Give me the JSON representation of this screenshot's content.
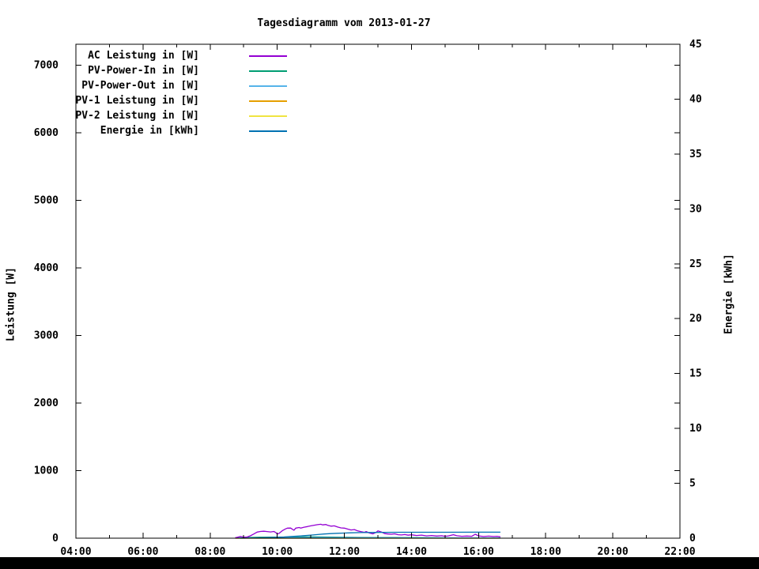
{
  "colors": {
    "background": "#ffffff",
    "foreground": "#000000",
    "bottom_bar": "#000000"
  },
  "chart_data": {
    "type": "line",
    "title": "Tagesdiagramm vom 2013-01-27",
    "x_axis": {
      "start_hour": 4,
      "end_hour": 22,
      "major_step_hours": 2,
      "minor_step_hours": 1,
      "tick_labels": [
        "04:00",
        "06:00",
        "08:00",
        "10:00",
        "12:00",
        "14:00",
        "16:00",
        "18:00",
        "20:00",
        "22:00"
      ]
    },
    "y_left": {
      "label": "Leistung [W]",
      "min": 0,
      "max": 7310,
      "tick_step": 1000,
      "ticks": [
        0,
        1000,
        2000,
        3000,
        4000,
        5000,
        6000,
        7000
      ]
    },
    "y_right": {
      "label": "Energie [kWh]",
      "min": 0,
      "max": 45,
      "tick_step": 5,
      "ticks": [
        0,
        5,
        10,
        15,
        20,
        25,
        30,
        35,
        40,
        45
      ]
    },
    "legend_position": "top-left-inside",
    "grid": false,
    "series": [
      {
        "name": "AC Leistung in [W]",
        "color": "#9400d3",
        "axis": "y1",
        "points": [
          [
            8.75,
            8
          ],
          [
            8.8,
            12
          ],
          [
            8.9,
            25
          ],
          [
            9.0,
            14
          ],
          [
            9.1,
            18
          ],
          [
            9.2,
            35
          ],
          [
            9.3,
            62
          ],
          [
            9.4,
            90
          ],
          [
            9.5,
            100
          ],
          [
            9.6,
            103
          ],
          [
            9.7,
            98
          ],
          [
            9.8,
            92
          ],
          [
            9.9,
            100
          ],
          [
            9.95,
            85
          ],
          [
            10.0,
            62
          ],
          [
            10.05,
            70
          ],
          [
            10.15,
            110
          ],
          [
            10.25,
            138
          ],
          [
            10.3,
            148
          ],
          [
            10.4,
            150
          ],
          [
            10.45,
            132
          ],
          [
            10.5,
            118
          ],
          [
            10.55,
            148
          ],
          [
            10.65,
            158
          ],
          [
            10.7,
            150
          ],
          [
            10.8,
            162
          ],
          [
            10.9,
            172
          ],
          [
            11.0,
            182
          ],
          [
            11.1,
            192
          ],
          [
            11.2,
            200
          ],
          [
            11.3,
            206
          ],
          [
            11.35,
            196
          ],
          [
            11.45,
            202
          ],
          [
            11.5,
            192
          ],
          [
            11.6,
            178
          ],
          [
            11.7,
            182
          ],
          [
            11.8,
            165
          ],
          [
            11.9,
            152
          ],
          [
            12.0,
            148
          ],
          [
            12.1,
            135
          ],
          [
            12.2,
            122
          ],
          [
            12.3,
            128
          ],
          [
            12.4,
            108
          ],
          [
            12.5,
            96
          ],
          [
            12.6,
            86
          ],
          [
            12.65,
            98
          ],
          [
            12.75,
            76
          ],
          [
            12.85,
            64
          ],
          [
            12.95,
            88
          ],
          [
            13.0,
            108
          ],
          [
            13.1,
            92
          ],
          [
            13.2,
            68
          ],
          [
            13.3,
            62
          ],
          [
            13.4,
            58
          ],
          [
            13.5,
            64
          ],
          [
            13.6,
            52
          ],
          [
            13.7,
            48
          ],
          [
            13.8,
            54
          ],
          [
            13.9,
            44
          ],
          [
            14.0,
            50
          ],
          [
            14.15,
            40
          ],
          [
            14.3,
            46
          ],
          [
            14.45,
            34
          ],
          [
            14.6,
            40
          ],
          [
            14.75,
            32
          ],
          [
            14.9,
            36
          ],
          [
            15.0,
            28
          ],
          [
            15.1,
            34
          ],
          [
            15.25,
            52
          ],
          [
            15.35,
            36
          ],
          [
            15.5,
            28
          ],
          [
            15.65,
            32
          ],
          [
            15.8,
            28
          ],
          [
            15.9,
            58
          ],
          [
            16.0,
            34
          ],
          [
            16.15,
            24
          ],
          [
            16.3,
            30
          ],
          [
            16.45,
            24
          ],
          [
            16.55,
            28
          ],
          [
            16.65,
            20
          ]
        ]
      },
      {
        "name": "PV-Power-In in [W]",
        "color": "#009e73",
        "axis": "y1",
        "points": [
          [
            8.75,
            4
          ],
          [
            9.0,
            8
          ],
          [
            9.5,
            14
          ],
          [
            10.0,
            16
          ],
          [
            10.5,
            18
          ],
          [
            11.0,
            20
          ],
          [
            11.5,
            18
          ],
          [
            12.0,
            14
          ],
          [
            12.5,
            12
          ],
          [
            13.0,
            10
          ],
          [
            13.5,
            9
          ],
          [
            14.0,
            8
          ],
          [
            14.5,
            7
          ],
          [
            15.0,
            6
          ],
          [
            15.5,
            5
          ],
          [
            16.0,
            5
          ],
          [
            16.65,
            4
          ]
        ]
      },
      {
        "name": "PV-Power-Out in [W]",
        "color": "#56b4e9",
        "axis": "y1",
        "points": [
          [
            8.75,
            2
          ],
          [
            9.5,
            5
          ],
          [
            10.5,
            8
          ],
          [
            11.2,
            10
          ],
          [
            12.0,
            8
          ],
          [
            13.0,
            6
          ],
          [
            14.0,
            5
          ],
          [
            15.0,
            4
          ],
          [
            16.65,
            3
          ]
        ]
      },
      {
        "name": "PV-1 Leistung in [W]",
        "color": "#e69f00",
        "axis": "y1",
        "points": [
          [
            8.75,
            0
          ],
          [
            16.65,
            0
          ]
        ]
      },
      {
        "name": "PV-2 Leistung in [W]",
        "color": "#f0e442",
        "axis": "y1",
        "points": [
          [
            8.75,
            0
          ],
          [
            16.65,
            0
          ]
        ]
      },
      {
        "name": "Energie in [kWh]",
        "color": "#0072b2",
        "axis": "y2",
        "points": [
          [
            8.9,
            0.0
          ],
          [
            9.2,
            0.01
          ],
          [
            9.5,
            0.03
          ],
          [
            9.8,
            0.06
          ],
          [
            10.0,
            0.08
          ],
          [
            10.2,
            0.11
          ],
          [
            10.4,
            0.15
          ],
          [
            10.6,
            0.19
          ],
          [
            10.8,
            0.23
          ],
          [
            11.0,
            0.28
          ],
          [
            11.2,
            0.33
          ],
          [
            11.4,
            0.38
          ],
          [
            11.6,
            0.42
          ],
          [
            11.8,
            0.45
          ],
          [
            12.0,
            0.47
          ],
          [
            12.2,
            0.49
          ],
          [
            12.5,
            0.51
          ],
          [
            12.8,
            0.52
          ],
          [
            13.2,
            0.53
          ],
          [
            14.0,
            0.54
          ],
          [
            15.0,
            0.54
          ],
          [
            16.0,
            0.55
          ],
          [
            16.65,
            0.55
          ]
        ]
      }
    ]
  }
}
